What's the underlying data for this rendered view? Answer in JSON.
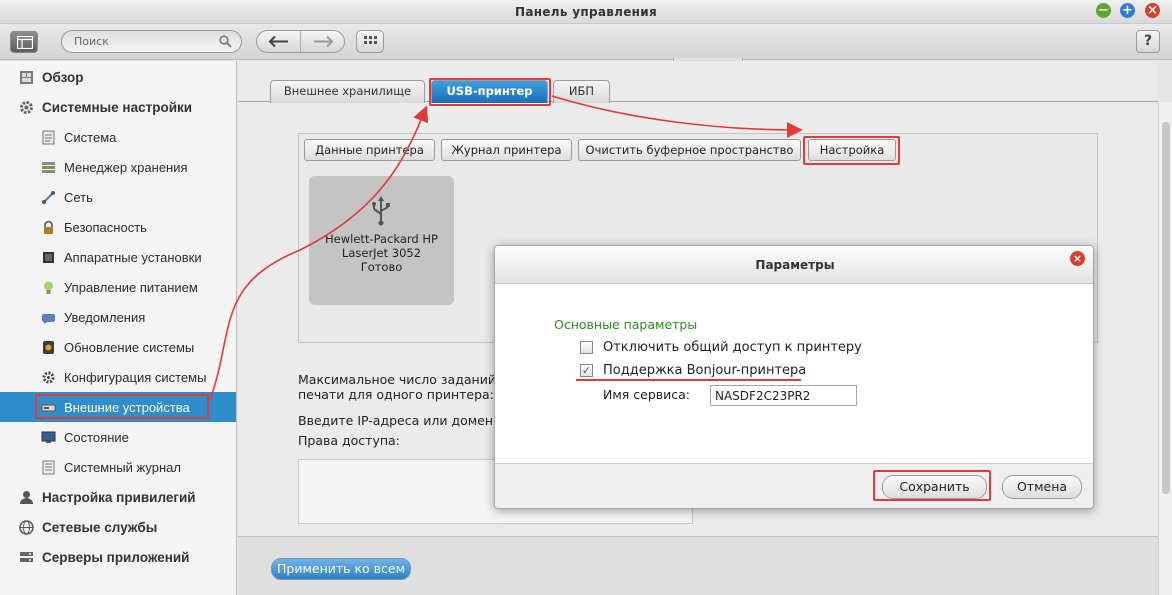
{
  "window": {
    "title": "Панель управления"
  },
  "toolbar": {
    "search_placeholder": "Поиск",
    "help_label": "?"
  },
  "sidebar": {
    "items": [
      {
        "label": "Обзор",
        "level": "top",
        "icon": "overview-icon"
      },
      {
        "label": "Системные настройки",
        "level": "top",
        "icon": "gear-icon"
      },
      {
        "label": "Система",
        "level": "sub",
        "icon": "system-icon"
      },
      {
        "label": "Менеджер хранения",
        "level": "sub",
        "icon": "storage-icon"
      },
      {
        "label": "Сеть",
        "level": "sub",
        "icon": "network-icon"
      },
      {
        "label": "Безопасность",
        "level": "sub",
        "icon": "lock-icon"
      },
      {
        "label": "Аппаратные установки",
        "level": "sub",
        "icon": "hardware-icon"
      },
      {
        "label": "Управление питанием",
        "level": "sub",
        "icon": "power-bulb-icon"
      },
      {
        "label": "Уведомления",
        "level": "sub",
        "icon": "notification-icon"
      },
      {
        "label": "Обновление системы",
        "level": "sub",
        "icon": "update-icon"
      },
      {
        "label": "Конфигурация системы",
        "level": "sub",
        "icon": "config-icon"
      },
      {
        "label": "Внешние устройства",
        "level": "sub",
        "icon": "external-device-icon",
        "active": true
      },
      {
        "label": "Состояние",
        "level": "sub",
        "icon": "monitor-icon"
      },
      {
        "label": "Системный журнал",
        "level": "sub",
        "icon": "log-icon"
      },
      {
        "label": "Настройка привилегий",
        "level": "top",
        "icon": "user-icon"
      },
      {
        "label": "Сетевые службы",
        "level": "top",
        "icon": "globe-icon"
      },
      {
        "label": "Серверы приложений",
        "level": "top",
        "icon": "server-icon"
      }
    ]
  },
  "tabs": [
    {
      "label": "Внешнее хранилище"
    },
    {
      "label": "USB-принтер",
      "active": true
    },
    {
      "label": "ИБП"
    }
  ],
  "printer_toolbar": {
    "buttons": [
      "Данные принтера",
      "Журнал принтера",
      "Очистить буферное пространство",
      "Настройка"
    ]
  },
  "printer": {
    "name": "Hewlett-Packard HP LaserJet 3052",
    "status": "Готово"
  },
  "form": {
    "max_jobs_label_1": "Максимальное число заданий",
    "max_jobs_label_2": "печати для одного принтера:",
    "ip_label": "Введите IP-адреса или домен",
    "access_label": "Права доступа:"
  },
  "footer": {
    "apply_label": "Применить ко всем"
  },
  "dialog": {
    "title": "Параметры",
    "section": "Основные параметры",
    "disable_sharing_label": "Отключить общий доступ к принтеру",
    "disable_sharing_checked": false,
    "bonjour_label": "Поддержка Bonjour-принтера",
    "bonjour_checked": true,
    "service_name_label": "Имя сервиса:",
    "service_name_value": "NASDF2C23PR2",
    "save_label": "Сохранить",
    "cancel_label": "Отмена"
  },
  "colors": {
    "accent": "#2f8ec9",
    "annotation_red": "#e03a3a",
    "section_green": "#2a8c1e",
    "close_red": "#d9402b",
    "minimize_green": "#5aa832",
    "maximize_blue": "#2e7fcf"
  }
}
